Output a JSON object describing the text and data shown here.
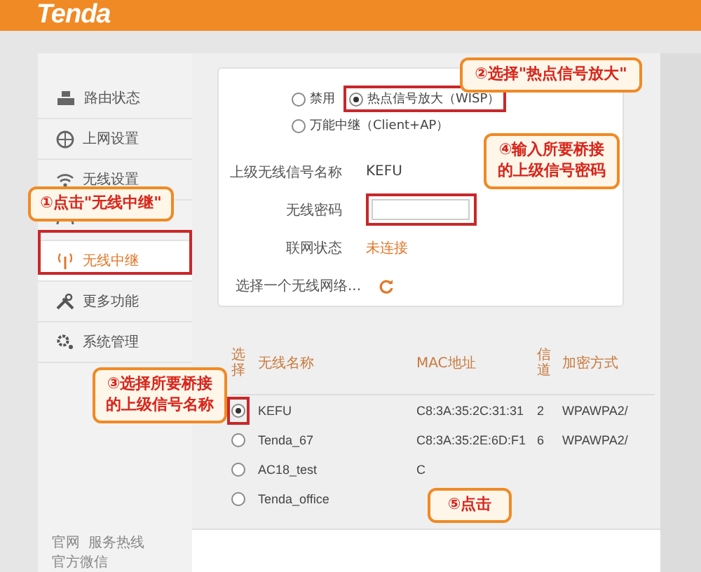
{
  "header": {
    "logo": "Tenda"
  },
  "sidebar": {
    "items": [
      {
        "label": "路由状态",
        "selected": false
      },
      {
        "label": "上网设置",
        "selected": false
      },
      {
        "label": "无线设置",
        "selected": false
      },
      {
        "selected": false
      },
      {
        "label": "无线中继",
        "selected": true
      },
      {
        "label": "更多功能",
        "selected": false
      },
      {
        "label": "系统管理",
        "selected": false
      }
    ],
    "footer": [
      "官网",
      "服务热线",
      "官方微信"
    ]
  },
  "form": {
    "modes": [
      {
        "label": "禁用",
        "selected": false
      },
      {
        "label": "热点信号放大（WISP）",
        "selected": true
      },
      {
        "label": "万能中继（Client+AP）",
        "selected": false
      }
    ],
    "upstream": {
      "label": "上级无线信号名称",
      "value": "KEFU"
    },
    "password": {
      "label": "无线密码"
    },
    "status": {
      "label": "联网状态",
      "value": "未连接"
    },
    "scan": {
      "label": "选择一个无线网络..."
    }
  },
  "table": {
    "columns": [
      "选择",
      "无线名称",
      "MAC地址",
      "信道",
      "加密方式"
    ],
    "rows": [
      {
        "selected": true,
        "name": "KEFU",
        "mac": "C8:3A:35:2C:31:31",
        "channel": "2",
        "security": "WPAWPA2/"
      },
      {
        "selected": false,
        "name": "Tenda_67",
        "mac": "C8:3A:35:2E:6D:F1",
        "channel": "6",
        "security": "WPAWPA2/"
      },
      {
        "selected": false,
        "name": "AC18_test",
        "mac": "C"
      },
      {
        "selected": false,
        "name": "Tenda_office"
      }
    ]
  },
  "callouts": [
    {
      "text": "①点击\"无线中继\""
    },
    {
      "text": "②选择\"热点信号放大\""
    },
    {
      "text": "④输入所要桥接的上级信号密码"
    },
    {
      "text": "③选择所要桥接的上级信号名称"
    },
    {
      "text": "⑤点击"
    }
  ]
}
